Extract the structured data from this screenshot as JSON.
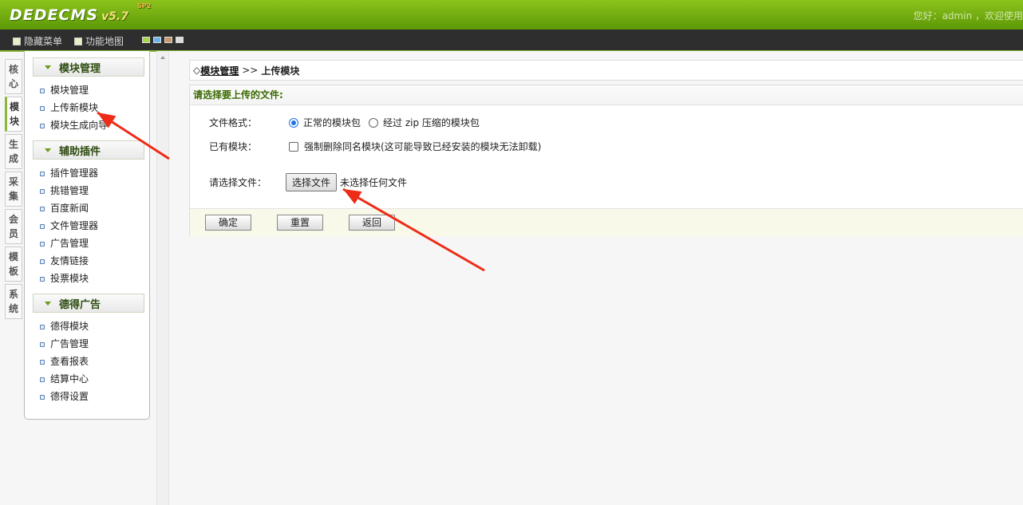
{
  "header": {
    "logo_text": "DEDECMS",
    "logo_version": "v5.7",
    "logo_edition": "SP2",
    "welcome": "您好：admin ，欢迎使用"
  },
  "toolbar": {
    "hide_menu": "隐藏菜单",
    "site_map": "功能地图",
    "skin_colors": [
      "#a6d64a",
      "#6fb3e6",
      "#c89a6a",
      "#dcdcdc"
    ]
  },
  "vtabs": [
    "核心",
    "模块",
    "生成",
    "采集",
    "会员",
    "模板",
    "系统"
  ],
  "menu": {
    "groups": [
      {
        "title": "模块管理",
        "items": [
          "模块管理",
          "上传新模块",
          "模块生成向导"
        ]
      },
      {
        "title": "辅助插件",
        "items": [
          "插件管理器",
          "挑错管理",
          "百度新闻",
          "文件管理器",
          "广告管理",
          "友情链接",
          "投票模块"
        ]
      },
      {
        "title": "德得广告",
        "items": [
          "德得模块",
          "广告管理",
          "查看报表",
          "结算中心",
          "德得设置"
        ]
      }
    ]
  },
  "breadcrumb": {
    "prefix": "◇",
    "link": "模块管理",
    "sep": ">>",
    "current": "上传模块"
  },
  "form": {
    "title": "请选择要上传的文件:",
    "format_label": "文件格式：",
    "format_option_normal": "正常的模块包",
    "format_option_zip": "经过 zip 压缩的模块包",
    "existing_label": "已有模块：",
    "existing_option": "强制删除同名模块(这可能导致已经安装的模块无法卸载)",
    "file_label": "请选择文件：",
    "file_button": "选择文件",
    "file_status": "未选择任何文件"
  },
  "buttons": {
    "confirm": "确定",
    "reset": "重置",
    "back": "返回"
  },
  "annotation_color": "#ee2b17"
}
